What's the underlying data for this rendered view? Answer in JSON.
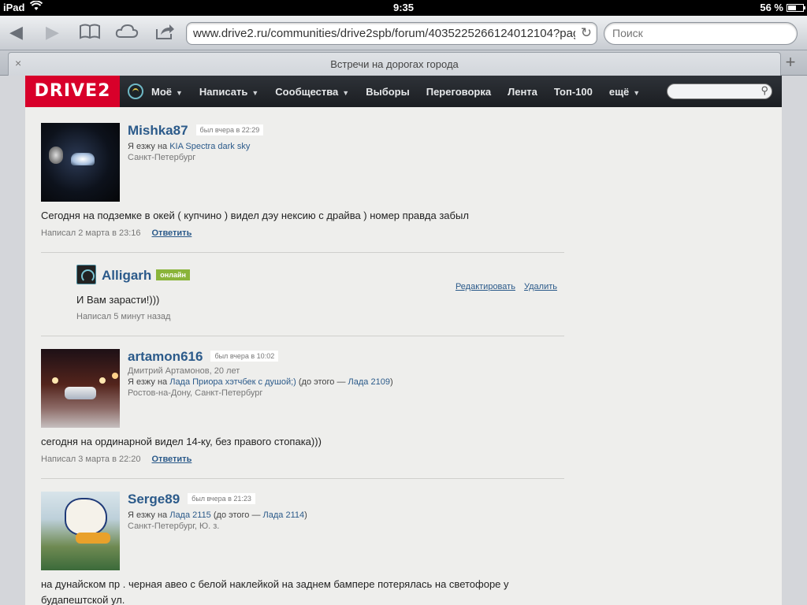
{
  "status": {
    "carrier": "iPad",
    "time": "9:35",
    "battery": "56 %"
  },
  "browser": {
    "url": "www.drive2.ru/communities/drive2spb/forum/4035225266124012104?pag",
    "search_placeholder": "Поиск",
    "tab_title": "Встречи на дорогах города",
    "tab_close": "×",
    "tab_add": "+"
  },
  "site": {
    "logo": "DRIVE2",
    "nav": [
      {
        "label": "Моё",
        "dropdown": true
      },
      {
        "label": "Написать",
        "dropdown": true
      },
      {
        "label": "Сообщества",
        "dropdown": true
      },
      {
        "label": "Выборы",
        "dropdown": false
      },
      {
        "label": "Переговорка",
        "dropdown": false
      },
      {
        "label": "Лента",
        "dropdown": false
      },
      {
        "label": "Топ-100",
        "dropdown": false
      },
      {
        "label": "ещё",
        "dropdown": true
      }
    ]
  },
  "posts": [
    {
      "user": "Mishka87",
      "seen": "был вчера в 22:29",
      "drives_prefix": "Я езжу на",
      "car": "KIA Spectra dark sky",
      "city": "Санкт-Петербург",
      "text": "Сегодня на подземке в окей ( купчино ) видел дэу нексию с драйва ) номер правда забыл",
      "posted": "Написал 2 марта в 23:16",
      "reply": "Ответить"
    },
    {
      "user": "artamon616",
      "seen": "был вчера в 10:02",
      "fullname": "Дмитрий Артамонов, 20 лет",
      "drives_prefix": "Я езжу на",
      "car": "Лада Приора хэтчбек с душой;)",
      "prev_prefix": "(до этого —",
      "prev_car": "Лада 2109",
      "prev_suffix": ")",
      "city": "Ростов-на-Дону, Санкт-Петербург",
      "text": "сегодня на ординарной видел 14-ку, без правого стопака)))",
      "posted": "Написал 3 марта в 22:20",
      "reply": "Ответить"
    },
    {
      "user": "Serge89",
      "seen": "был вчера в 21:23",
      "drives_prefix": "Я езжу на",
      "car": "Лада 2115",
      "prev_prefix": "(до этого —",
      "prev_car": "Лада 2114",
      "prev_suffix": ")",
      "city": "Санкт-Петербург, Ю. з.",
      "text": "на дунайском пр . черная авео с белой наклейкой на заднем бампере потерялась на светофоре у будапештской ул."
    }
  ],
  "my_reply": {
    "user": "Alligarh",
    "badge": "онлайн",
    "text": "И Вам зарасти!)))",
    "posted": "Написал 5 минут назад",
    "edit": "Редактировать",
    "delete": "Удалить"
  }
}
